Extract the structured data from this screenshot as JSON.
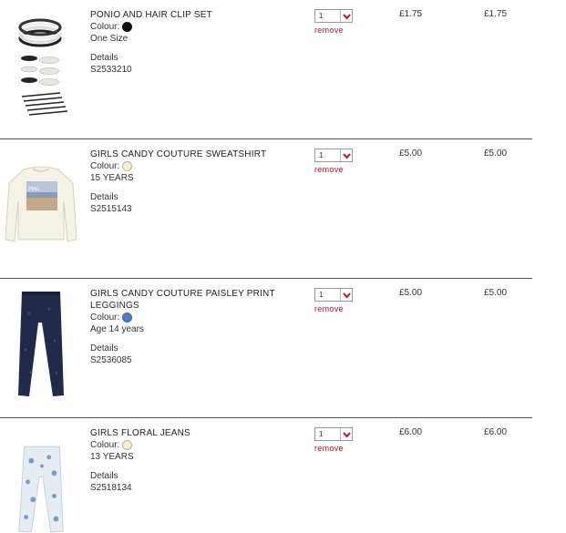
{
  "accent_color": "#c8102e",
  "items": [
    {
      "title": "PONIO AND HAIR CLIP SET",
      "colour_label": "Colour:",
      "colour_swatch": "#111111",
      "size": "One Size",
      "details_label": "Details",
      "code": "S2533210",
      "quantity": "1",
      "remove_label": "remove",
      "unit_price": "£1.75",
      "total_price": "£1.75",
      "image_icon": "hair-accessories-image"
    },
    {
      "title": "GIRLS CANDY COUTURE SWEATSHIRT",
      "colour_label": "Colour:",
      "colour_swatch": "#f3efd8",
      "size": "15 YEARS",
      "details_label": "Details",
      "code": "S2515143",
      "quantity": "1",
      "remove_label": "remove",
      "unit_price": "£5.00",
      "total_price": "£5.00",
      "image_icon": "sweatshirt-image"
    },
    {
      "title": "GIRLS CANDY COUTURE PAISLEY PRINT LEGGINGS",
      "colour_label": "Colour:",
      "colour_swatch": "#4a7fc6",
      "size": "Age 14 years",
      "details_label": "Details",
      "code": "S2536085",
      "quantity": "1",
      "remove_label": "remove",
      "unit_price": "£5.00",
      "total_price": "£5.00",
      "image_icon": "leggings-image"
    },
    {
      "title": "GIRLS FLORAL JEANS",
      "colour_label": "Colour:",
      "colour_swatch": "#f3efd8",
      "size": "13 YEARS",
      "details_label": "Details",
      "code": "S2518134",
      "quantity": "1",
      "remove_label": "remove",
      "unit_price": "£6.00",
      "total_price": "£6.00",
      "image_icon": "floral-jeans-image"
    }
  ]
}
